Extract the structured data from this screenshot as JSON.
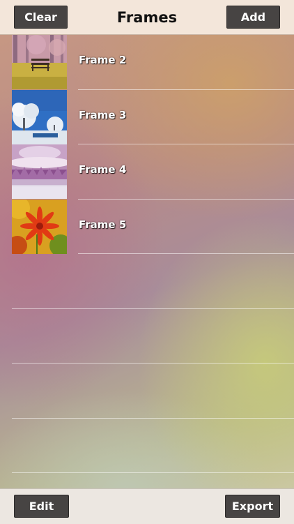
{
  "header": {
    "title": "Frames",
    "clear_label": "Clear",
    "add_label": "Add"
  },
  "frames": [
    {
      "label": "Frame 2",
      "thumbnail": "autumn bench"
    },
    {
      "label": "Frame 3",
      "thumbnail": "snowy trees"
    },
    {
      "label": "Frame 4",
      "thumbnail": "winter forest"
    },
    {
      "label": "Frame 5",
      "thumbnail": "red flower"
    }
  ],
  "footer": {
    "edit_label": "Edit",
    "export_label": "Export"
  }
}
